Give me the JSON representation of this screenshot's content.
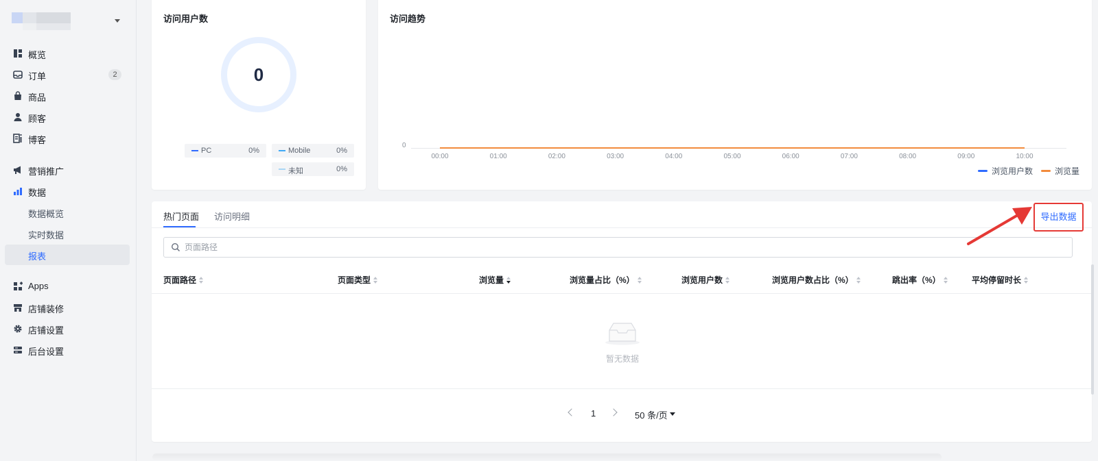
{
  "sidebar": {
    "items": [
      {
        "label": "概览",
        "icon": "dashboard-icon"
      },
      {
        "label": "订单",
        "icon": "inbox-icon",
        "badge": "2"
      },
      {
        "label": "商品",
        "icon": "shopping-bag-icon"
      },
      {
        "label": "顾客",
        "icon": "user-icon"
      },
      {
        "label": "博客",
        "icon": "blog-icon"
      },
      {
        "label": "营销推广",
        "icon": "megaphone-icon"
      },
      {
        "label": "数据",
        "icon": "bar-chart-icon"
      },
      {
        "label": "数据概览"
      },
      {
        "label": "实时数据"
      },
      {
        "label": "报表",
        "active": true
      },
      {
        "label": "Apps",
        "icon": "apps-icon"
      },
      {
        "label": "店铺装修",
        "icon": "storefront-icon"
      },
      {
        "label": "店铺设置",
        "icon": "gear-icon"
      },
      {
        "label": "后台设置",
        "icon": "server-icon"
      }
    ]
  },
  "visitors_card": {
    "title": "访问用户数",
    "total": "0",
    "legend": [
      {
        "name": "PC",
        "percent": "0%",
        "color": "#2f6bff"
      },
      {
        "name": "Mobile",
        "percent": "0%",
        "color": "#3fa9f5"
      },
      {
        "name": "未知",
        "percent": "0%",
        "color": "#a9d6f5"
      }
    ]
  },
  "trend_card": {
    "title": "访问趋势",
    "legend": [
      {
        "name": "浏览用户数",
        "color": "#2f6bff"
      },
      {
        "name": "浏览量",
        "color": "#f28b3c"
      }
    ]
  },
  "chart_data": {
    "type": "line",
    "title": "访问趋势",
    "x": [
      "00:00",
      "01:00",
      "02:00",
      "03:00",
      "04:00",
      "05:00",
      "06:00",
      "07:00",
      "08:00",
      "09:00",
      "10:00"
    ],
    "y_ticks": [
      "0"
    ],
    "series": [
      {
        "name": "浏览用户数",
        "values": [
          0,
          0,
          0,
          0,
          0,
          0,
          0,
          0,
          0,
          0,
          0
        ]
      },
      {
        "name": "浏览量",
        "values": [
          0,
          0,
          0,
          0,
          0,
          0,
          0,
          0,
          0,
          0,
          0
        ]
      }
    ],
    "legend_position": "bottom-right"
  },
  "pages_card": {
    "tabs": [
      "热门页面",
      "访问明细"
    ],
    "export_label": "导出数据",
    "search_placeholder": "页面路径",
    "columns": [
      "页面路径",
      "页面类型",
      "浏览量",
      "浏览量占比（%）",
      "浏览用户数",
      "浏览用户数占比（%）",
      "跳出率（%）",
      "平均停留时长"
    ],
    "empty_text": "暂无数据",
    "pagination": {
      "current_page": "1",
      "page_size": "50 条/页"
    }
  }
}
